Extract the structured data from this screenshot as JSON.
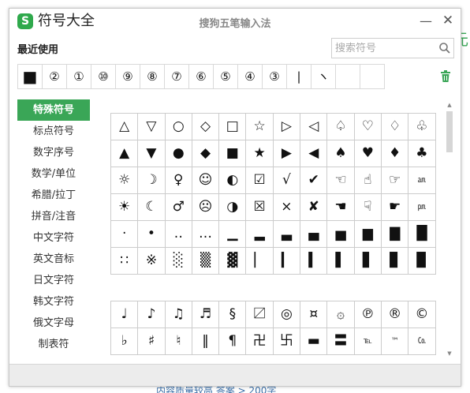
{
  "window": {
    "logo_letter": "S",
    "title": "符号大全",
    "ime_title": "搜狗五笔输入法",
    "minimize_glyph": "—",
    "close_glyph": "✕"
  },
  "background": {
    "right_fragment": "元",
    "bottom_fragment": "内容质量较高   答案 > 200字"
  },
  "recent": {
    "label": "最近使用",
    "items": [
      "■",
      "②",
      "①",
      "⑩",
      "⑨",
      "⑧",
      "⑦",
      "⑥",
      "⑤",
      "④",
      "③",
      "|",
      "ヽ",
      "",
      ""
    ]
  },
  "search": {
    "placeholder": "搜索符号",
    "value": ""
  },
  "sidebar": {
    "items": [
      {
        "label": "特殊符号",
        "active": true
      },
      {
        "label": "标点符号",
        "active": false
      },
      {
        "label": "数字序号",
        "active": false
      },
      {
        "label": "数学/单位",
        "active": false
      },
      {
        "label": "希腊/拉丁",
        "active": false
      },
      {
        "label": "拼音/注音",
        "active": false
      },
      {
        "label": "中文字符",
        "active": false
      },
      {
        "label": "英文音标",
        "active": false
      },
      {
        "label": "日文字符",
        "active": false
      },
      {
        "label": "韩文字符",
        "active": false
      },
      {
        "label": "俄文字母",
        "active": false
      },
      {
        "label": "制表符",
        "active": false
      }
    ]
  },
  "symbols_1": [
    [
      "△",
      "▽",
      "○",
      "◇",
      "□",
      "☆",
      "▷",
      "◁",
      "♤",
      "♡",
      "♢",
      "♧"
    ],
    [
      "▲",
      "▼",
      "●",
      "◆",
      "■",
      "★",
      "▶",
      "◀",
      "♠",
      "♥",
      "♦",
      "♣"
    ],
    [
      "☼",
      "☽",
      "♀",
      "☺",
      "◐",
      "☑",
      "√",
      "✔",
      "☜",
      "☝",
      "☞",
      "㏂"
    ],
    [
      "☀",
      "☾",
      "♂",
      "☹",
      "◑",
      "☒",
      "×",
      "✘",
      "☚",
      "☟",
      "☛",
      "㏘"
    ],
    [
      "·",
      "•",
      "‥",
      "…",
      "▁",
      "▂",
      "▃",
      "▄",
      "▅",
      "▆",
      "▇",
      "█"
    ],
    [
      "∷",
      "※",
      "░",
      "▒",
      "▓",
      "▏",
      "▎",
      "▍",
      "▌",
      "▋",
      "▊",
      "▉"
    ]
  ],
  "symbols_2": [
    [
      "♩",
      "♪",
      "♫",
      "♬",
      "§",
      "〼",
      "◎",
      "¤",
      "۞",
      "℗",
      "®",
      "©"
    ],
    [
      "♭",
      "♯",
      "♮",
      "‖",
      "¶",
      "卍",
      "卐",
      "▬",
      "〓",
      "℡",
      "™",
      "㏇"
    ]
  ],
  "colors": {
    "accent_green": "#3aa657",
    "grid_border": "#cccccc"
  }
}
